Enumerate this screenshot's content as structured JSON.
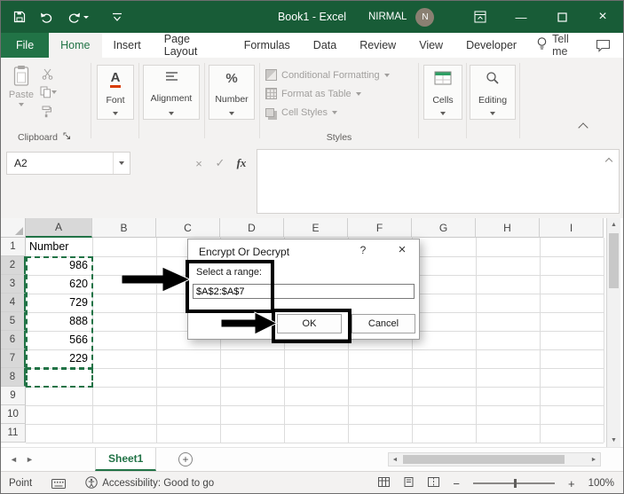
{
  "window": {
    "title": "Book1 - Excel",
    "user_name": "NIRMAL",
    "user_initial": "N"
  },
  "ribbon_tabs": {
    "file": "File",
    "items": [
      "Home",
      "Insert",
      "Page Layout",
      "Formulas",
      "Data",
      "Review",
      "View",
      "Developer"
    ],
    "active": "Home",
    "tell_me": "Tell me"
  },
  "ribbon": {
    "paste": "Paste",
    "clipboard_label": "Clipboard",
    "font_label": "Font",
    "font_icon": "A",
    "alignment_label": "Alignment",
    "number_label": "Number",
    "number_icon": "%",
    "styles": [
      "Conditional Formatting",
      "Format as Table",
      "Cell Styles"
    ],
    "styles_label": "Styles",
    "cells_label": "Cells",
    "editing_label": "Editing"
  },
  "formula_bar": {
    "name_box": "A2",
    "fx_label": "fx"
  },
  "grid": {
    "col_headers": [
      "A",
      "B",
      "C",
      "D",
      "E",
      "F",
      "G",
      "H",
      "I"
    ],
    "row_headers": [
      "1",
      "2",
      "3",
      "4",
      "5",
      "6",
      "7",
      "8",
      "9",
      "10",
      "11"
    ],
    "selected_column": "A",
    "selected_rows": [
      2,
      3,
      4,
      5,
      6,
      7,
      8
    ],
    "cells": [
      {
        "ref": "A1",
        "value": "Number",
        "align": "left"
      },
      {
        "ref": "A2",
        "value": "986",
        "align": "right"
      },
      {
        "ref": "A3",
        "value": "620",
        "align": "right"
      },
      {
        "ref": "A4",
        "value": "729",
        "align": "right"
      },
      {
        "ref": "A5",
        "value": "888",
        "align": "right"
      },
      {
        "ref": "A6",
        "value": "566",
        "align": "right"
      },
      {
        "ref": "A7",
        "value": "229",
        "align": "right"
      }
    ]
  },
  "dialog": {
    "title": "Encrypt Or Decrypt",
    "help_label": "?",
    "close_label": "×",
    "range_label": "Select a range:",
    "range_value": "$A$2:$A$7",
    "ok_label": "OK",
    "cancel_label": "Cancel"
  },
  "sheet_bar": {
    "sheet_name": "Sheet1",
    "new_sheet_label": "+"
  },
  "status_bar": {
    "mode": "Point",
    "accessibility": "Accessibility: Good to go",
    "zoom_level": "100%"
  },
  "icons": {
    "minimize_glyph": "—",
    "close_glyph": "×",
    "cancel_glyph": "×",
    "check_glyph": "✓",
    "left_glyph": "◄",
    "right_glyph": "►",
    "up_glyph": "▲",
    "down_glyph": "▼",
    "minus_glyph": "−",
    "plus_glyph": "+"
  },
  "colors": {
    "excel_green": "#217346",
    "titlebar_green": "#185c37",
    "annotation_black": "#000000"
  }
}
